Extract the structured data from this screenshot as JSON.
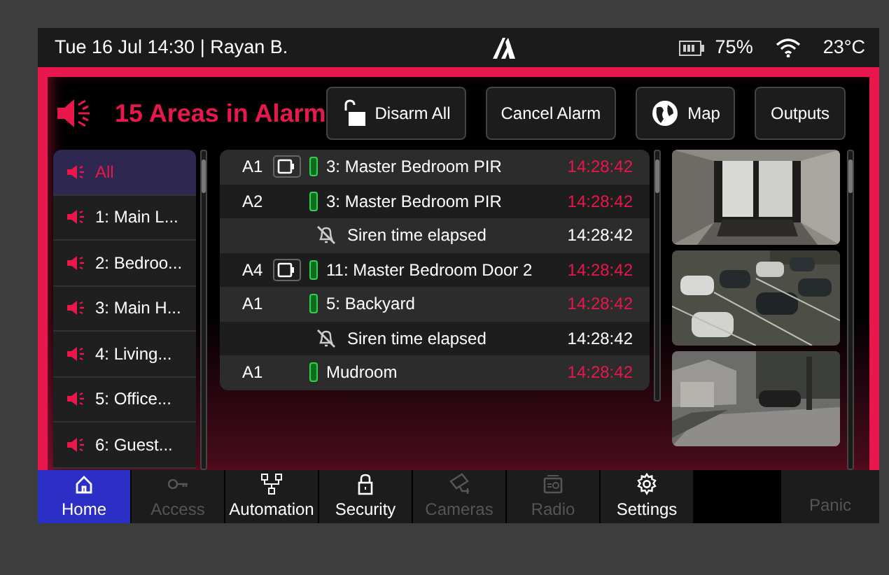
{
  "status_bar": {
    "datetime_user": "Tue 16 Jul 14:30 | Rayan B.",
    "battery": "75%",
    "temperature": "23°C"
  },
  "alarm": {
    "title": "15 Areas in Alarm",
    "buttons": [
      {
        "label": "Disarm All"
      },
      {
        "label": "Cancel Alarm"
      },
      {
        "label": "Map"
      },
      {
        "label": "Outputs"
      }
    ]
  },
  "areas": [
    {
      "label": "All",
      "selected": true
    },
    {
      "label": "1: Main L...",
      "selected": false
    },
    {
      "label": "2: Bedroo...",
      "selected": false
    },
    {
      "label": "3: Main H...",
      "selected": false
    },
    {
      "label": "4: Living...",
      "selected": false
    },
    {
      "label": "5: Office...",
      "selected": false
    },
    {
      "label": "6: Guest...",
      "selected": false
    }
  ],
  "events": [
    {
      "kind": "zone",
      "area": "A1",
      "camera": true,
      "label": "3: Master Bedroom PIR",
      "time": "14:28:42",
      "alarm": true
    },
    {
      "kind": "zone",
      "area": "A2",
      "camera": false,
      "label": "3: Master Bedroom PIR",
      "time": "14:28:42",
      "alarm": true
    },
    {
      "kind": "siren",
      "label": "Siren time elapsed",
      "time": "14:28:42",
      "alarm": false
    },
    {
      "kind": "zone",
      "area": "A4",
      "camera": true,
      "label": "11: Master Bedroom Door 2",
      "time": "14:28:42",
      "alarm": true
    },
    {
      "kind": "zone",
      "area": "A1",
      "camera": false,
      "label": "5: Backyard",
      "time": "14:28:42",
      "alarm": true
    },
    {
      "kind": "siren",
      "label": "Siren time elapsed",
      "time": "14:28:42",
      "alarm": false
    },
    {
      "kind": "zone",
      "area": "A1",
      "camera": false,
      "label": "Mudroom",
      "time": "14:28:42",
      "alarm": true
    }
  ],
  "nav": [
    {
      "label": "Home",
      "selected": true,
      "disabled": false
    },
    {
      "label": "Access",
      "selected": false,
      "disabled": true
    },
    {
      "label": "Automation",
      "selected": false,
      "disabled": false
    },
    {
      "label": "Security",
      "selected": false,
      "disabled": false
    },
    {
      "label": "Cameras",
      "selected": false,
      "disabled": true
    },
    {
      "label": "Radio",
      "selected": false,
      "disabled": true
    },
    {
      "label": "Settings",
      "selected": false,
      "disabled": false
    },
    {
      "kind": "blank"
    },
    {
      "label": "Panic",
      "selected": false,
      "disabled": true
    }
  ]
}
